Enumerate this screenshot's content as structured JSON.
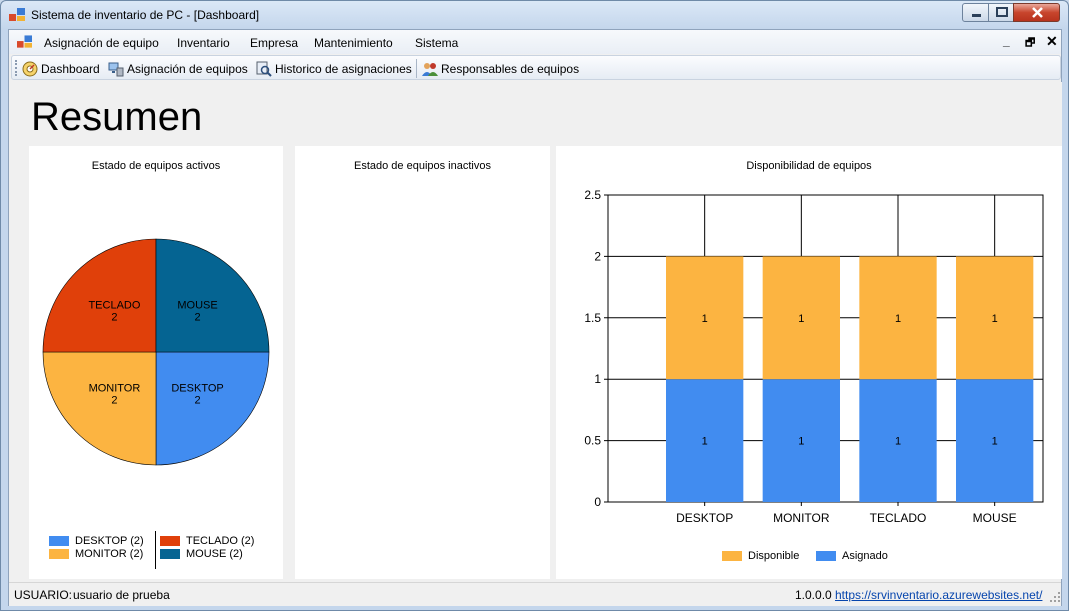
{
  "window": {
    "title": "Sistema de inventario de PC - [Dashboard]"
  },
  "menu": {
    "items": [
      "Asignación de equipo",
      "Inventario",
      "Empresa",
      "Mantenimiento",
      "Sistema"
    ]
  },
  "toolbar": {
    "buttons": [
      {
        "label": "Dashboard",
        "icon": "dashboard-icon"
      },
      {
        "label": "Asignación de equipos",
        "icon": "computer-assign-icon"
      },
      {
        "label": "Historico de asignaciones",
        "icon": "history-search-icon"
      },
      {
        "label": "Responsables de equipos",
        "icon": "users-group-icon"
      }
    ]
  },
  "page": {
    "title": "Resumen"
  },
  "panels": {
    "active": {
      "title": "Estado de equipos activos",
      "legend": [
        "DESKTOP (2)",
        "MONITOR (2)",
        "TECLADO (2)",
        "MOUSE (2)"
      ]
    },
    "inactive": {
      "title": "Estado de equipos inactivos"
    },
    "availability": {
      "title": "Disponibilidad de equipos",
      "legend": [
        "Disponible",
        "Asignado"
      ]
    }
  },
  "chart_data": [
    {
      "type": "pie",
      "title": "Estado de equipos activos",
      "categories": [
        "DESKTOP",
        "MONITOR",
        "TECLADO",
        "MOUSE"
      ],
      "values": [
        2,
        2,
        2,
        2
      ],
      "colors": [
        "#418cf0",
        "#fcb441",
        "#e0400a",
        "#056492"
      ],
      "legend_position": "bottom"
    },
    {
      "type": "bar",
      "stacked": true,
      "title": "Disponibilidad de equipos",
      "categories": [
        "DESKTOP",
        "MONITOR",
        "TECLADO",
        "MOUSE"
      ],
      "series": [
        {
          "name": "Asignado",
          "values": [
            1,
            1,
            1,
            1
          ],
          "color": "#418cf0"
        },
        {
          "name": "Disponible",
          "values": [
            1,
            1,
            1,
            1
          ],
          "color": "#fcb441"
        }
      ],
      "ylim": [
        0,
        2.5
      ],
      "yticks": [
        "0",
        "0.5",
        "1",
        "1.5",
        "2",
        "2.5"
      ],
      "grid": true,
      "legend_position": "bottom"
    }
  ],
  "status": {
    "user_label": "USUARIO:",
    "user_value": "usuario de prueba",
    "version": "1.0.0.0",
    "link": "https://srvinventario.azurewebsites.net/"
  }
}
